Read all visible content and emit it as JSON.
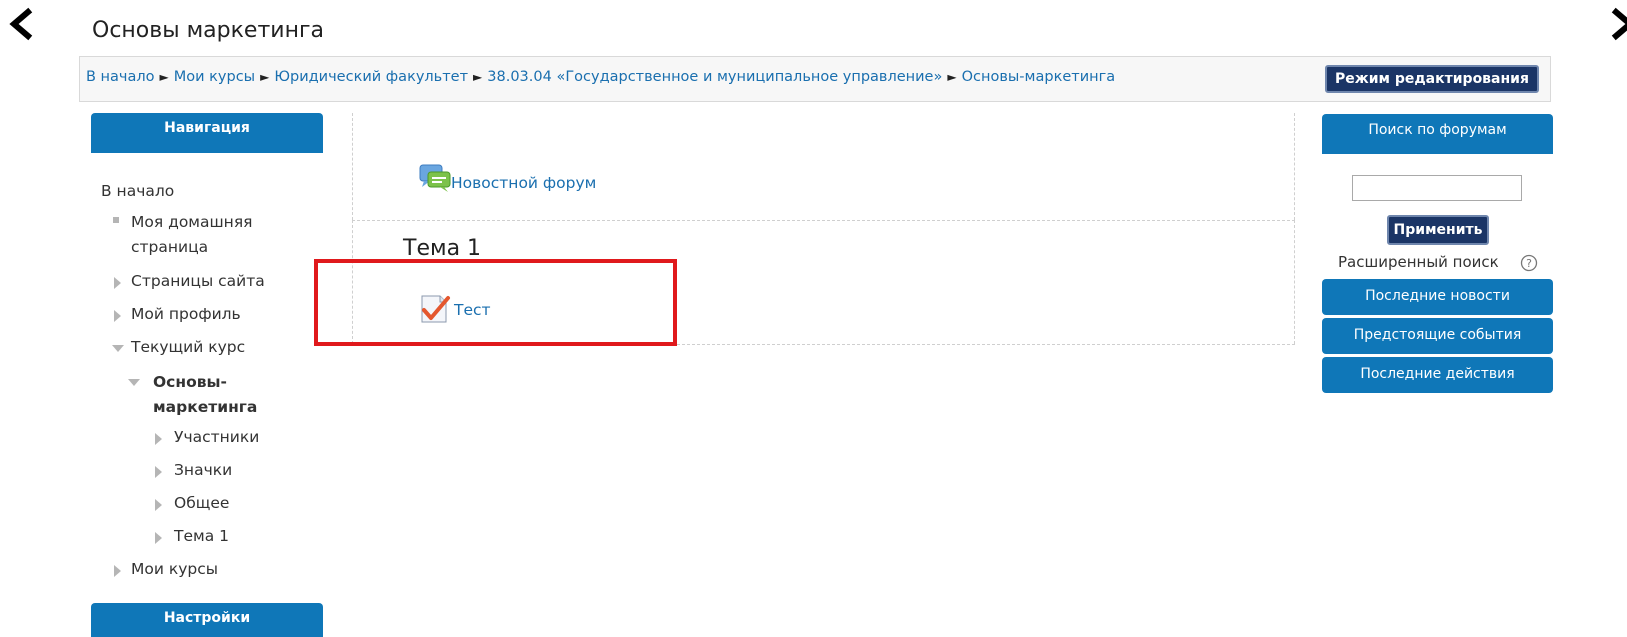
{
  "page_title": "Основы маркетинга",
  "breadcrumb": {
    "items": [
      "В начало",
      "Мои курсы",
      "Юридический факультет",
      "38.03.04 «Государственное и муниципальное управление»",
      "Основы-маркетинга"
    ],
    "separator": "►"
  },
  "edit_mode_button": "Режим редактирования",
  "navigation": {
    "title": "Навигация",
    "home": "В начало",
    "items": {
      "my_home": "Моя домашняя страница",
      "site_pages": "Страницы сайта",
      "my_profile": "Мой профиль",
      "current_course": "Текущий курс",
      "course": "Основы-маркетинга",
      "participants": "Участники",
      "badges": "Значки",
      "general": "Общее",
      "topic1": "Тема 1",
      "my_courses": "Мои курсы"
    }
  },
  "settings": {
    "title": "Настройки"
  },
  "course": {
    "news_forum": "Новостной форум",
    "topic_title": "Тема 1",
    "test_link": "Тест"
  },
  "forum_search": {
    "title": "Поиск по форумам",
    "input_value": "",
    "apply_button": "Применить",
    "advanced": "Расширенный поиск"
  },
  "blocks": {
    "latest_news": "Последние новости",
    "upcoming_events": "Предстоящие события",
    "recent_activity": "Последние действия"
  },
  "colors": {
    "block_header": "#0f77b8",
    "button_dark": "#1b3566",
    "link": "#1a6faf",
    "highlight": "#e0191c"
  }
}
